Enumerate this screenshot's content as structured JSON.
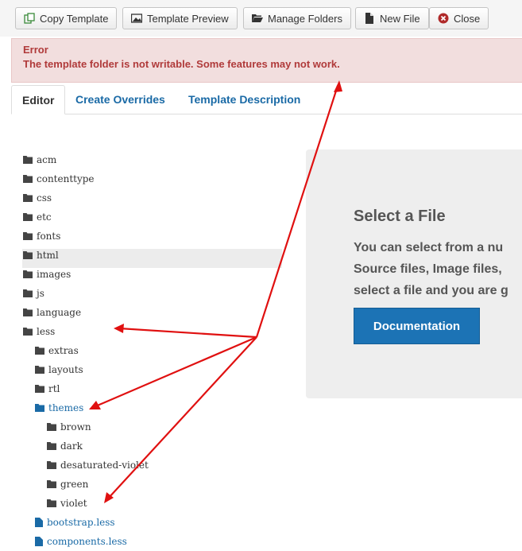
{
  "toolbar": {
    "copy_template": "Copy Template",
    "template_preview": "Template Preview",
    "manage_folders": "Manage Folders",
    "new_file": "New File",
    "close": "Close"
  },
  "alert": {
    "heading": "Error",
    "message": "The template folder is not writable. Some features may not work."
  },
  "tabs": {
    "editor": "Editor",
    "create_overrides": "Create Overrides",
    "template_description": "Template Description"
  },
  "tree": {
    "acm": "acm",
    "contenttype": "contenttype",
    "css": "css",
    "etc": "etc",
    "fonts": "fonts",
    "html": "html",
    "images": "images",
    "js": "js",
    "language": "language",
    "less": "less",
    "extras": "extras",
    "layouts": "layouts",
    "rtl": "rtl",
    "themes": "themes",
    "brown": "brown",
    "dark": "dark",
    "desaturated_violet": "desaturated-violet",
    "green": "green",
    "violet": "violet",
    "bootstrap_less": "bootstrap.less",
    "components_less": "components.less"
  },
  "panel": {
    "title": "Select a File",
    "line1": "You can select from a nu",
    "line2": "Source files, Image files,",
    "line3": "select a file and you are g",
    "button": "Documentation"
  },
  "colors": {
    "link": "#1a6aa6",
    "alert_bg": "#f2dede",
    "alert_text": "#b03a3a",
    "primary_button": "#1c73b5",
    "annotation_arrow": "#e01010"
  }
}
